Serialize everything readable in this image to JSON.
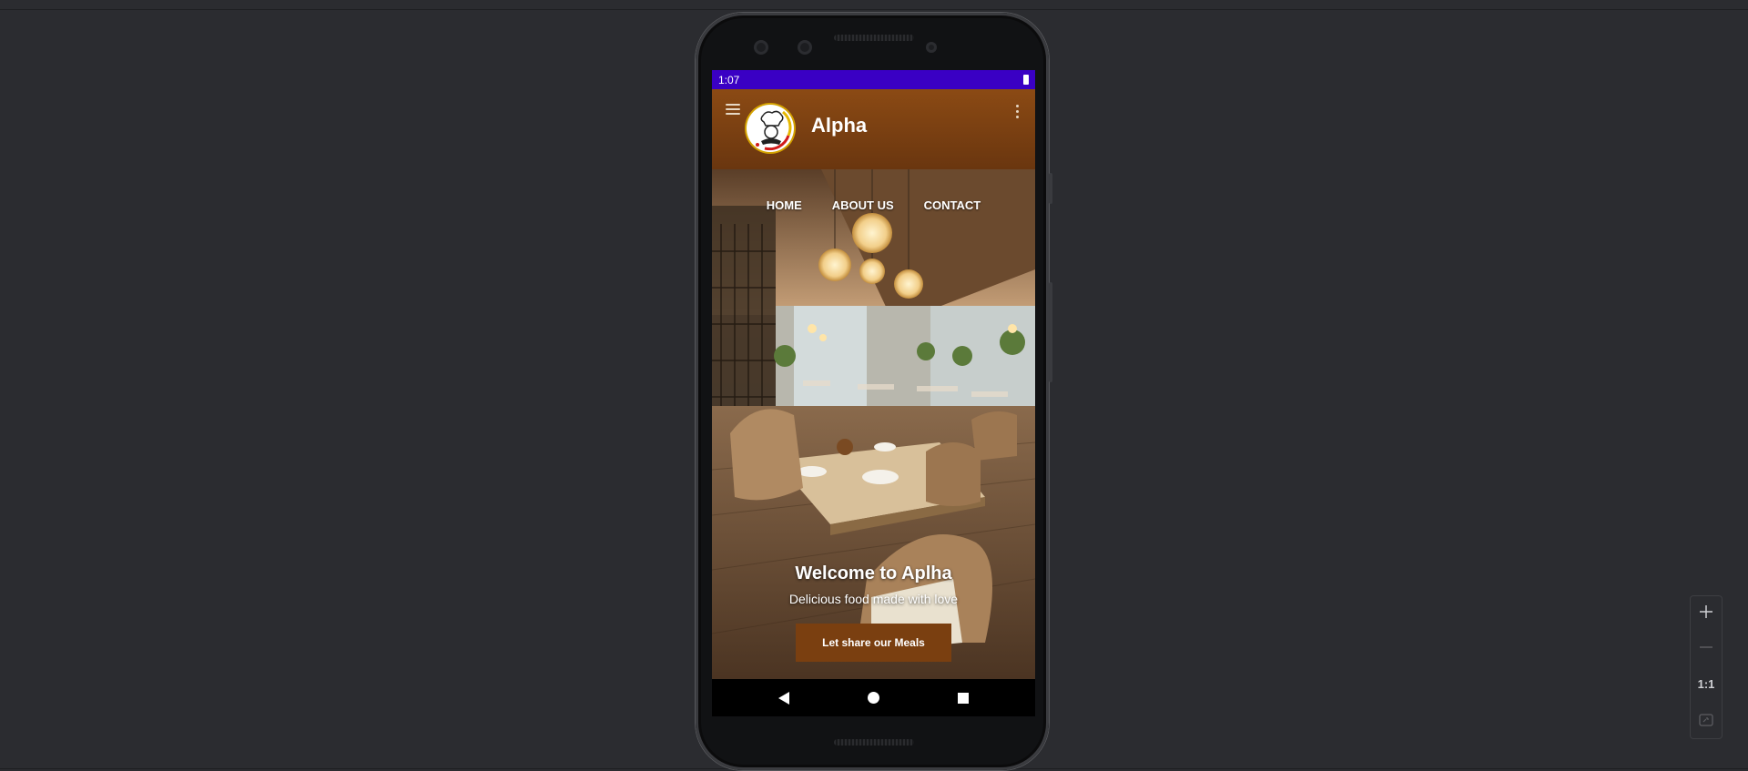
{
  "statusbar": {
    "time": "1:07"
  },
  "appbar": {
    "title": "Alpha"
  },
  "hero": {
    "nav": [
      "HOME",
      "ABOUT US",
      "CONTACT"
    ],
    "title": "Welcome to Aplha",
    "subtitle": "Delicious food made with love",
    "cta_label": "Let share our Meals"
  },
  "zoom_toolbar": {
    "actual_size_label": "1:1"
  },
  "icons": {
    "menu": "hamburger-icon",
    "overflow": "more-vert-icon",
    "back": "back-triangle-icon",
    "home": "home-circle-icon",
    "recents": "recents-square-icon",
    "zoom_in": "plus-icon",
    "zoom_out": "minus-icon",
    "fit": "fit-screen-icon"
  },
  "colors": {
    "statusbar": "#3a00c4",
    "appbar": "#8b4a14",
    "cta": "#7a3f10",
    "ide_background": "#2b2c30"
  }
}
